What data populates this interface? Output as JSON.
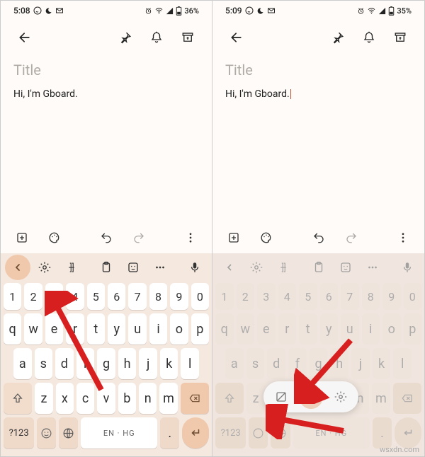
{
  "left": {
    "status": {
      "time": "5:08",
      "battery": "36%"
    },
    "title_placeholder": "Title",
    "body": "Hi, I'm Gboard.",
    "spacebar": "EN · HG",
    "symkey": "?123"
  },
  "right": {
    "status": {
      "time": "5:09",
      "battery": "35%"
    },
    "title_placeholder": "Title",
    "body": "Hi, I'm Gboard.",
    "spacebar": "EN · HG",
    "symkey": "?123"
  },
  "keys": {
    "nums": [
      "1",
      "2",
      "3",
      "4",
      "5",
      "6",
      "7",
      "8",
      "9",
      "0"
    ],
    "r1": [
      "q",
      "w",
      "e",
      "r",
      "t",
      "y",
      "u",
      "i",
      "o",
      "p"
    ],
    "r2": [
      "a",
      "s",
      "d",
      "f",
      "g",
      "h",
      "j",
      "k",
      "l"
    ],
    "r3": [
      "z",
      "x",
      "c",
      "v",
      "b",
      "n",
      "m"
    ]
  },
  "watermark": "wsxdn.com"
}
